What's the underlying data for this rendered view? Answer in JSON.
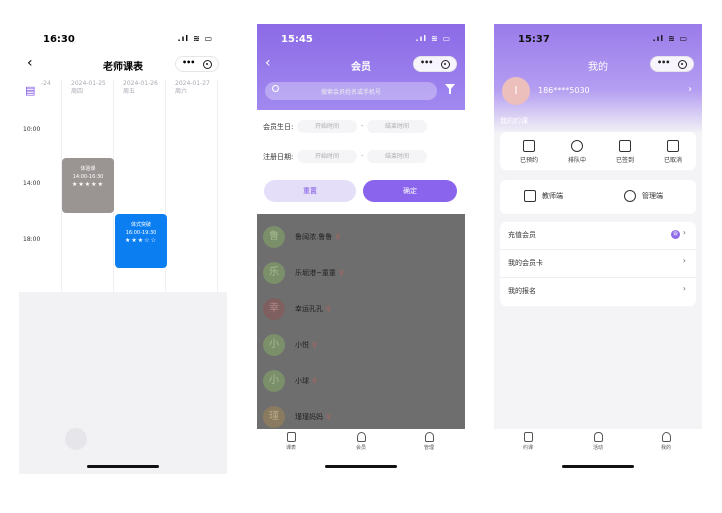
{
  "phone1": {
    "status_time": "16:30",
    "status_icons": ".ıl ≋ ▭",
    "title": "老师课表",
    "back": "‹",
    "calendar_icon": "calendar-icon",
    "days": [
      {
        "date": "-24",
        "weekday": ""
      },
      {
        "date": "2024-01-25",
        "weekday": "周四"
      },
      {
        "date": "2024-01-26",
        "weekday": "周五"
      },
      {
        "date": "2024-01-27",
        "weekday": "周六"
      }
    ],
    "times": [
      "10:00",
      "14:00",
      "18:00"
    ],
    "courses": [
      {
        "name": "体验课",
        "time": "14:00-16:30",
        "stars": "★★★★★",
        "color": "#9a9493"
      },
      {
        "name": "体式突破",
        "time": "16:00-19:30",
        "stars": "★★★☆☆",
        "color": "#0b7ff2"
      }
    ]
  },
  "phone2": {
    "status_time": "15:45",
    "status_icons": ".ıl ≋ ▭",
    "title": "会员",
    "back": "‹",
    "search_placeholder": "搜索会员姓名或手机号",
    "filter_rows": [
      {
        "label": "会员生日:",
        "start": "开始时间",
        "sep": "-",
        "end": "结束时间"
      },
      {
        "label": "注册日期:",
        "start": "开始时间",
        "sep": "-",
        "end": "结束时间"
      }
    ],
    "reset": "重置",
    "confirm": "确定",
    "members": [
      {
        "avatar": "鲁",
        "name": "鲁阔浓.鲁鲁"
      },
      {
        "avatar": "乐",
        "name": "乐堀港~童童"
      },
      {
        "avatar": "幸",
        "name": "幸运孔孔"
      },
      {
        "avatar": "小",
        "name": "小悦"
      },
      {
        "avatar": "小",
        "name": "小球"
      },
      {
        "avatar": "瑾",
        "name": "瑾瑾妈妈"
      }
    ],
    "female_symbol": "♀",
    "tabs": [
      "课表",
      "会员",
      "管理"
    ]
  },
  "phone3": {
    "status_time": "15:37",
    "status_icons": ".ıl ≋ ▭",
    "title": "我的",
    "avatar_letter": "I",
    "phone": "186****5030",
    "section": "我的约课",
    "ops": [
      "已预约",
      "排队中",
      "已签到",
      "已取消"
    ],
    "roles": [
      "教师端",
      "管理端"
    ],
    "menu": [
      {
        "label": "充值会员",
        "badge": "会"
      },
      {
        "label": "我的会员卡"
      },
      {
        "label": "我的报名"
      }
    ],
    "tabs": [
      "约课",
      "活动",
      "我的"
    ],
    "chevron": "›"
  }
}
